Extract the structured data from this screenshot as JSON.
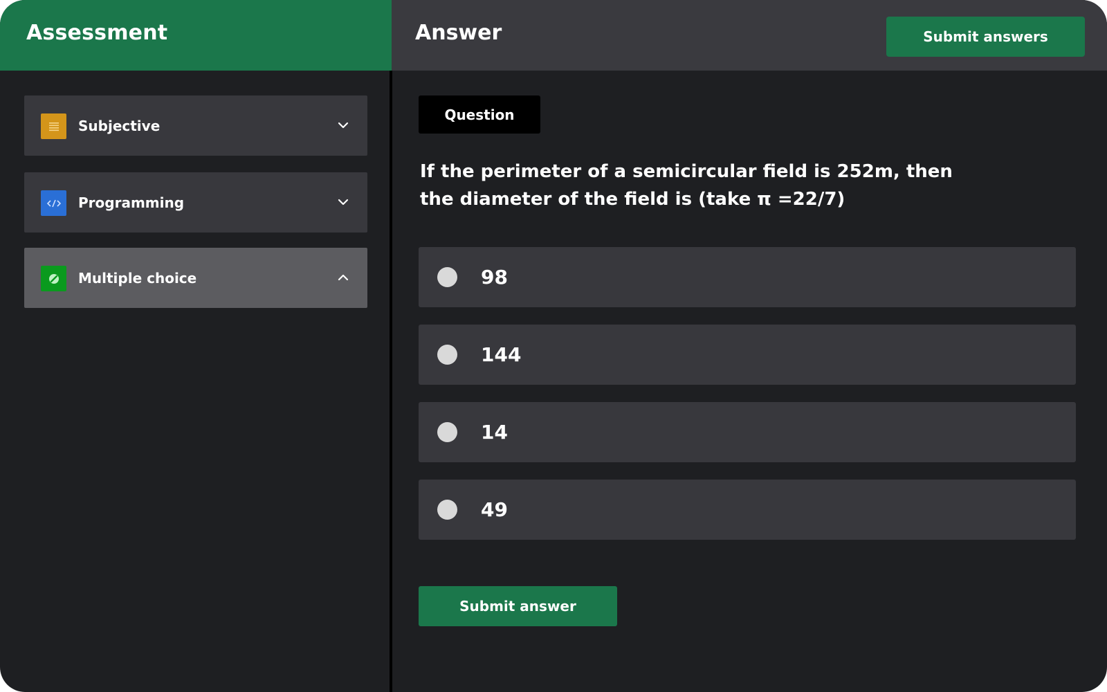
{
  "left_panel": {
    "title": "Assessment",
    "sections": [
      {
        "label": "Subjective",
        "icon": "document-lines-icon",
        "icon_color": "#d4951a",
        "state": "collapsed"
      },
      {
        "label": "Programming",
        "icon": "code-icon",
        "icon_color": "#2a6fd6",
        "state": "collapsed"
      },
      {
        "label": "Multiple choice",
        "icon": "check-circle-icon",
        "icon_color": "#0a9a1e",
        "state": "expanded"
      }
    ]
  },
  "right_panel": {
    "title": "Answer",
    "submit_all_label": "Submit answers",
    "question_tag": "Question",
    "question_text": "If the perimeter of a semicircular field is 252m, then the diameter of the field is (take π =22/7)",
    "options": [
      "98",
      "144",
      "14",
      "49"
    ],
    "submit_label": "Submit answer"
  },
  "colors": {
    "accent": "#1b774b",
    "background": "#1e1f22",
    "panel": "#38383d",
    "panel_active": "#5c5c60"
  }
}
